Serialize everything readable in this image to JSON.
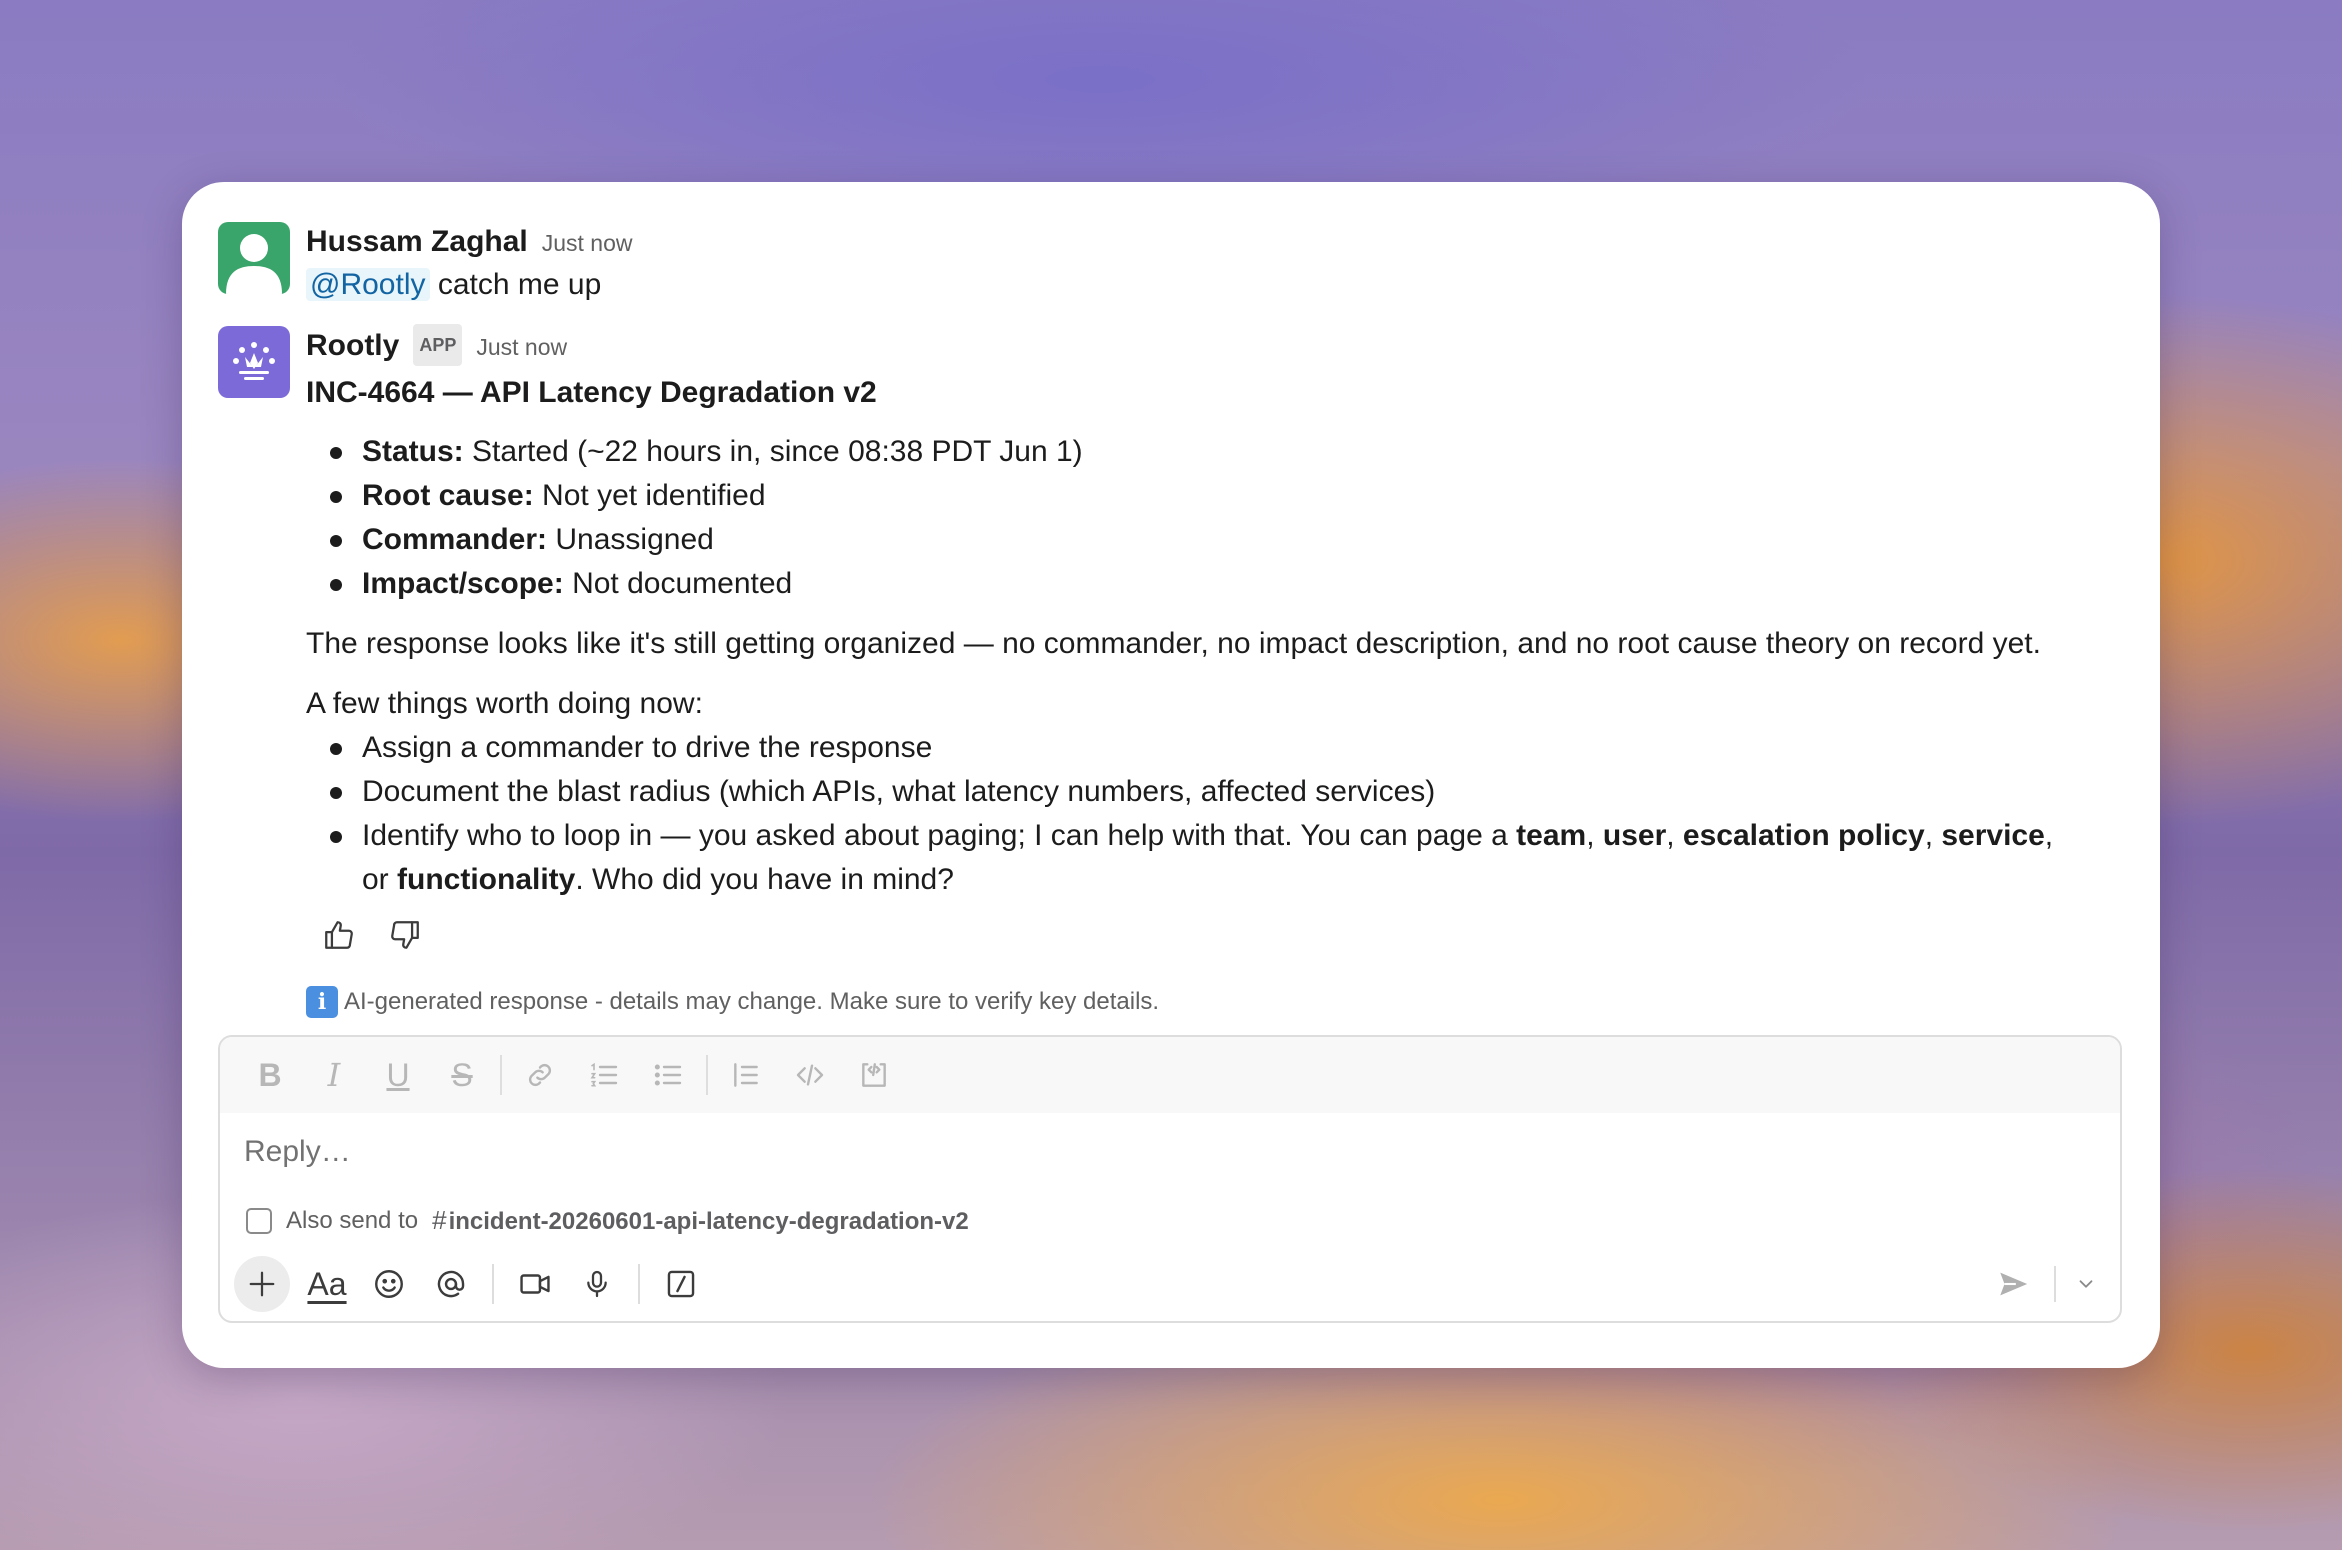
{
  "messages": {
    "user_msg": {
      "author": "Hussam Zaghal",
      "time": "Just now",
      "mention": "@Rootly",
      "text": "catch me up"
    },
    "bot_msg": {
      "author": "Rootly",
      "badge": "APP",
      "time": "Just now",
      "title": "INC-4664 — API Latency Degradation v2",
      "summary_items": [
        {
          "label": "Status:",
          "value": "Started (~22 hours in, since 08:38 PDT Jun 1)"
        },
        {
          "label": "Root cause:",
          "value": "Not yet identified"
        },
        {
          "label": "Commander:",
          "value": "Unassigned"
        },
        {
          "label": "Impact/scope:",
          "value": "Not documented"
        }
      ],
      "paragraph": "The response looks like it's still getting organized — no commander, no impact description, and no root cause theory on record yet.",
      "actions_intro": "A few things worth doing now:",
      "action_items": [
        "Assign a commander to drive the response",
        "Document the blast radius (which APIs, what latency numbers, affected services)"
      ],
      "action_last": {
        "pre": "Identify who to loop in — you asked about paging; I can help with that. You can page a ",
        "team": "team",
        "sep1": ", ",
        "user": "user",
        "sep2": ", ",
        "policy": "escalation policy",
        "sep3": ", ",
        "service": "service",
        "sep4": ", or",
        "functionality": "functionality",
        "post": ". Who did you have in mind?"
      },
      "disclaimer_icon": "i",
      "disclaimer": "AI-generated response - details may change. Make sure to verify key details."
    }
  },
  "composer": {
    "placeholder": "Reply…",
    "also_send_label": "Also send to",
    "channel_hash": "#",
    "channel": "incident-20260601-api-latency-degradation-v2",
    "format_buttons": {
      "bold": "B",
      "italic": "I",
      "underline": "U",
      "strike": "S"
    },
    "text_format_label": "Aa"
  },
  "colors": {
    "mention": "#1264a3",
    "user_avatar": "#3aa56b",
    "bot_avatar": "#7b6ad8"
  }
}
